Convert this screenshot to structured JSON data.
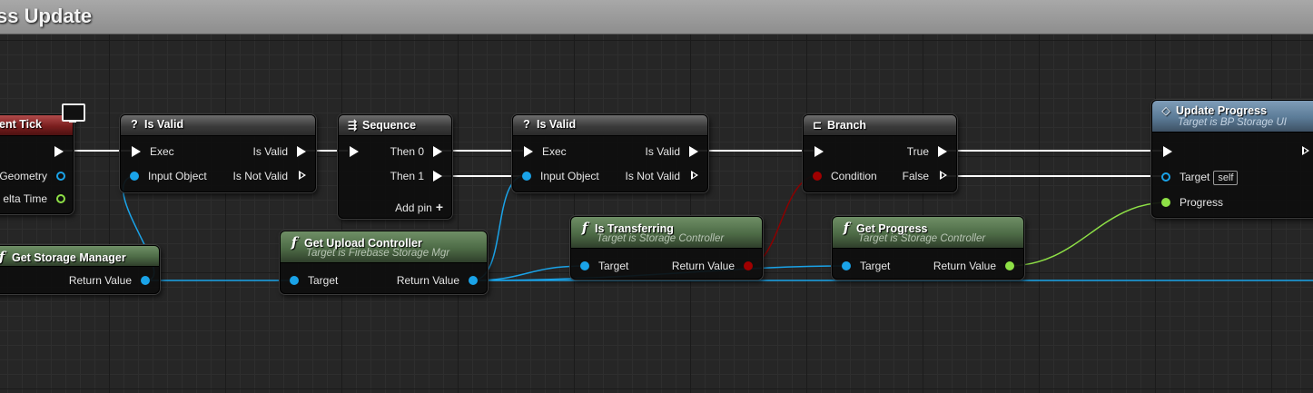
{
  "graph": {
    "title": "ss Update"
  },
  "nodes": {
    "event_tick": {
      "title": "ent Tick",
      "pins": {
        "geometry": "Geometry",
        "delta_time": "elta Time"
      }
    },
    "is_valid_1": {
      "glyph": "?",
      "title": "Is Valid",
      "pins": {
        "exec": "Exec",
        "input_object": "Input Object",
        "is_valid": "Is Valid",
        "is_not_valid": "Is Not Valid"
      }
    },
    "sequence": {
      "glyph": "⇶",
      "title": "Sequence",
      "pins": {
        "then_0": "Then 0",
        "then_1": "Then 1",
        "add_pin": "Add pin"
      },
      "add_glyph": "+"
    },
    "is_valid_2": {
      "glyph": "?",
      "title": "Is Valid",
      "pins": {
        "exec": "Exec",
        "input_object": "Input Object",
        "is_valid": "Is Valid",
        "is_not_valid": "Is Not Valid"
      }
    },
    "branch": {
      "glyph": "⊏",
      "title": "Branch",
      "pins": {
        "condition": "Condition",
        "true": "True",
        "false": "False"
      }
    },
    "update_progress": {
      "glyph": "◇",
      "title": "Update Progress",
      "subtitle": "Target is BP Storage UI",
      "pins": {
        "target": "Target",
        "self": "self",
        "progress": "Progress"
      }
    },
    "get_storage_manager": {
      "glyph": "f",
      "title": "Get Storage Manager",
      "pins": {
        "return_value": "Return Value"
      }
    },
    "get_upload_controller": {
      "glyph": "f",
      "title": "Get Upload Controller",
      "subtitle": "Target is Firebase Storage Mgr",
      "pins": {
        "target": "Target",
        "return_value": "Return Value"
      }
    },
    "is_transferring": {
      "glyph": "f",
      "title": "Is Transferring",
      "subtitle": "Target is Storage Controller",
      "pins": {
        "target": "Target",
        "return_value": "Return Value"
      }
    },
    "get_progress": {
      "glyph": "f",
      "title": "Get Progress",
      "subtitle": "Target is Storage Controller",
      "pins": {
        "target": "Target",
        "return_value": "Return Value"
      }
    }
  },
  "colors": {
    "exec_wire": "#ffffff",
    "object_wire": "#1aa3e8",
    "bool_wire": "#8b0000",
    "float_wire": "#8ee046"
  }
}
